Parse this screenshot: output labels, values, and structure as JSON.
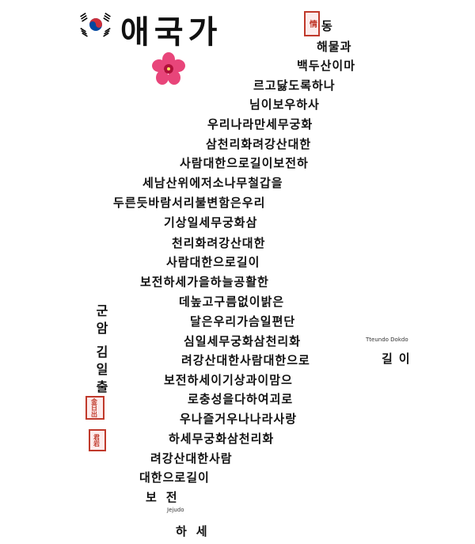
{
  "title": "애국가",
  "lines": [
    "동",
    "해물과",
    "백두산이마",
    "르고닳도록하나",
    "님이보우하사",
    "우리나라만세무궁화",
    "삼천리화려강산대한",
    "사람대한으로길이보전하",
    "세남산위에저소나무철갑을",
    "두른듯바람서리불변함은우리",
    "기상일세무궁화삼",
    "천리화려강산대한",
    "사람대한으로길이",
    "보전하세가을하늘공활한",
    "데높고구름없이밝은",
    "달은우리가슴일편단",
    "심일세무궁화삼천리화",
    "려강산대한사람대한으로",
    "보전하세이기상과이맘으",
    "로충성을다하여괴로",
    "우나즐거우나나라사랑",
    "하세무궁화삼천리화",
    "려강산대한사람",
    "대한으로길이",
    "보전",
    "하세"
  ],
  "side_label": "Tteundo Dokdo",
  "side_text": "길이",
  "jejudo_label": "Jejudo",
  "signature": {
    "col1": "군암",
    "col2": "김일출"
  },
  "seals": {
    "top": "情",
    "mid": "金日出",
    "low": "君岩"
  }
}
